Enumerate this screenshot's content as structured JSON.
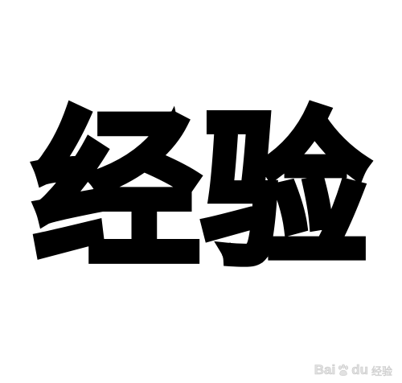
{
  "headline": {
    "chars": [
      "经",
      "验"
    ]
  },
  "watermark": {
    "brand_left": "Bai",
    "brand_right": "du",
    "sub": "经验"
  },
  "colors": {
    "ink": "#000000",
    "background": "#ffffff",
    "watermark": "#c9c9c9"
  },
  "icons": [
    "baidu-paw-icon"
  ]
}
